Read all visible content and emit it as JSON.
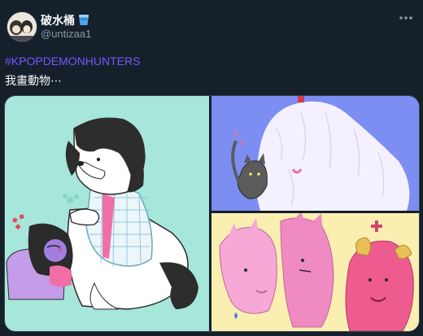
{
  "tweet": {
    "display_name": "破水桶",
    "handle": "@untizaa1",
    "hashtag": "#KPOPDEMONHUNTERS",
    "body_text": "我畫動物⋯",
    "verified_emoji": "bucket-icon"
  },
  "icons": {
    "more": "more-options-icon"
  },
  "colors": {
    "background": "#15202b",
    "link": "#1d9bf0",
    "panel1_bg": "#a7e6da",
    "panel2_bg": "#7c8ef2",
    "panel3_bg": "#faefb1"
  }
}
